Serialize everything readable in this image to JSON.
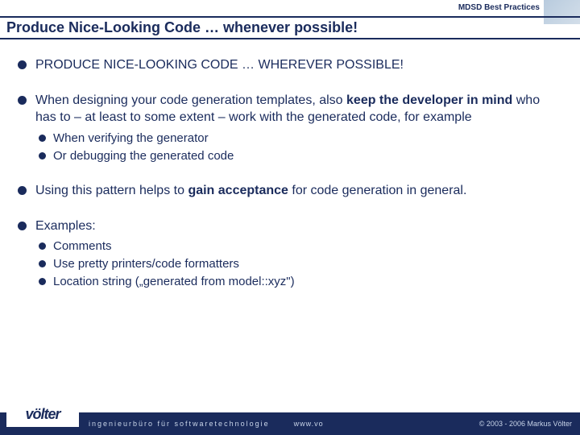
{
  "header_tag": "MDSD Best Practices",
  "title": "Produce Nice-Looking Code … whenever possible!",
  "bullets": {
    "b1": "PRODUCE NICE-LOOKING CODE … WHEREVER POSSIBLE!",
    "b2_a": "When designing your code generation templates, also ",
    "b2_bold": "keep the developer in mind",
    "b2_b": " who has to – at least to some extent – work with the generated code, for example",
    "b2_sub1": "When verifying the generator",
    "b2_sub2": "Or debugging the generated code",
    "b3_a": "Using this pattern helps to ",
    "b3_bold": "gain acceptance",
    "b3_b": " for code generation in general.",
    "b4": "Examples:",
    "b4_sub1": "Comments",
    "b4_sub2": "Use pretty printers/code formatters",
    "b4_sub3": "Location string („generated from model::xyz\")"
  },
  "logo": "völter",
  "footer_left": "ingenieurbüro für softwaretechnologie",
  "footer_mid": "www.vo",
  "footer_right": "© 2003 - 2006 Markus Völter"
}
